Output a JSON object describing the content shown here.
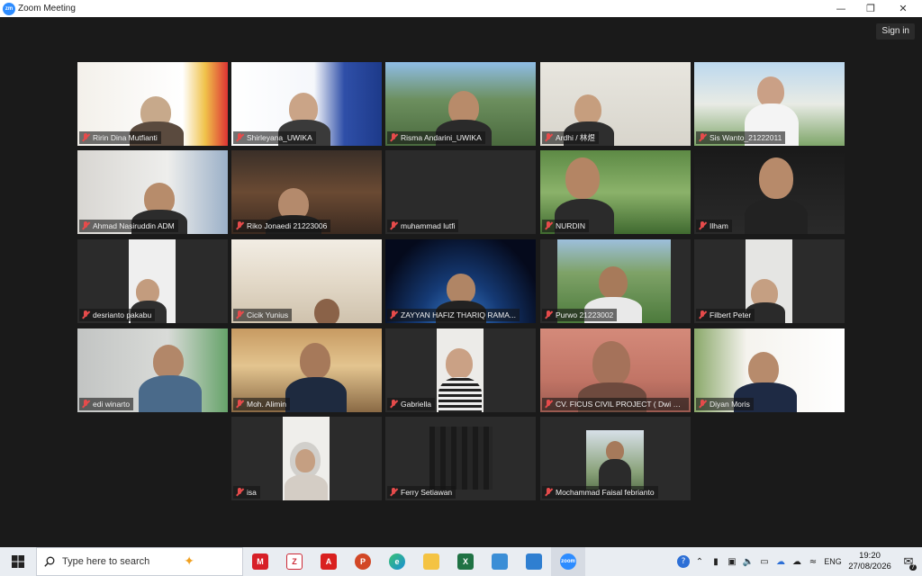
{
  "window": {
    "title": "Zoom Meeting",
    "app_logo": "zm",
    "controls": [
      "minimize-icon",
      "maximize-icon",
      "close-icon"
    ]
  },
  "header": {
    "sign_in": "Sign in"
  },
  "participants": [
    {
      "name": "Ririn Dina Mutfianti",
      "muted": true,
      "active": false
    },
    {
      "name": "Shirleyana_UWIKA",
      "muted": true,
      "active": false
    },
    {
      "name": "Risma Andarini_UWIKA",
      "muted": true,
      "active": true
    },
    {
      "name": "Ardhi / 林煜",
      "muted": true,
      "active": false
    },
    {
      "name": "Sis Wanto_21222011",
      "muted": true,
      "active": false
    },
    {
      "name": "Ahmad Nasiruddin ADM",
      "muted": true,
      "active": false
    },
    {
      "name": "Riko Jonaedi 21223006",
      "muted": true,
      "active": false
    },
    {
      "name": "muhammad lutfi",
      "muted": true,
      "active": false
    },
    {
      "name": "NURDIN",
      "muted": true,
      "active": false
    },
    {
      "name": "Ilham",
      "muted": true,
      "active": false
    },
    {
      "name": "desrianto pakabu",
      "muted": true,
      "active": false
    },
    {
      "name": "Cicik Yunius",
      "muted": true,
      "active": false
    },
    {
      "name": "ZAYYAN HAFIZ THARIQ RAMA...",
      "muted": true,
      "active": false
    },
    {
      "name": "Purwo 21223002",
      "muted": true,
      "active": false
    },
    {
      "name": "Filbert Peter",
      "muted": true,
      "active": false
    },
    {
      "name": "edi winarto",
      "muted": true,
      "active": false
    },
    {
      "name": "Moh. Alimin",
      "muted": true,
      "active": false
    },
    {
      "name": "Gabriella",
      "muted": true,
      "active": false
    },
    {
      "name": "CV. FICUS CIVIL PROJECT ( Dwi Pri...",
      "muted": true,
      "active": false
    },
    {
      "name": "Diyan Moris",
      "muted": true,
      "active": false
    },
    {
      "name": "isa",
      "muted": true,
      "active": false
    },
    {
      "name": "Ferry Setiawan",
      "muted": true,
      "active": false
    },
    {
      "name": "Mochammad Faisal febrianto",
      "muted": true,
      "active": false
    }
  ],
  "taskbar": {
    "search_placeholder": "Type here to search",
    "apps": [
      {
        "icon": "mendeley-icon",
        "glyph": "M",
        "color": "#d71f27"
      },
      {
        "icon": "zotero-icon",
        "glyph": "Z",
        "color": "#cc2936"
      },
      {
        "icon": "acrobat-icon",
        "glyph": "A",
        "color": "#d9201f"
      },
      {
        "icon": "powerpoint-icon",
        "glyph": "P",
        "color": "#d24726"
      },
      {
        "icon": "edge-icon",
        "glyph": "e",
        "color": "#1a8fd6"
      },
      {
        "icon": "file-explorer-icon",
        "glyph": "",
        "color": "#f4c343"
      },
      {
        "icon": "excel-icon",
        "glyph": "X",
        "color": "#1f7244"
      },
      {
        "icon": "photos-icon",
        "glyph": "",
        "color": "#3b8ed6"
      },
      {
        "icon": "paint-icon",
        "glyph": "",
        "color": "#2f7fd1"
      },
      {
        "icon": "zoom-icon",
        "glyph": "zoom",
        "color": "#2d8cff"
      }
    ],
    "tray": {
      "language": "ENG",
      "time": "19:20",
      "date": "27/08/2026",
      "notification_count": "7"
    }
  }
}
